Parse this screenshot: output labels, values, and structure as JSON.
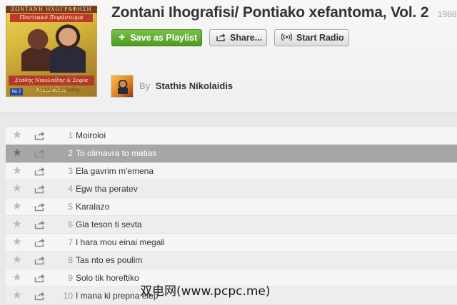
{
  "album": {
    "title": "Zontani Ihografisi/ Pontiako xefantoma, Vol. 2",
    "year": "1988",
    "cover_icon": "album-cover-image"
  },
  "cover_art": {
    "top_band": "ΖΩΝΤΑΝΗ ΗΧΟΓΡΑΦΗΣΗ",
    "title": "Ποντιακό Ξεφάντωμα",
    "artists": "Στάθης Νικολαΐδης & Σοφία Νικολαΐδου",
    "tag": "No 2",
    "sub": "Στάθης Νικολαΐδης"
  },
  "actions": {
    "save_label": "Save as Playlist",
    "share_label": "Share...",
    "radio_label": "Start Radio",
    "save_icon": "plus-icon",
    "share_icon": "share-arrow-icon",
    "radio_icon": "broadcast-icon"
  },
  "artist": {
    "by_label": "By",
    "name": "Stathis Nikolaidis"
  },
  "colors": {
    "save_button": "#5aa82a",
    "selected_row": "#a6a6a6"
  },
  "tracks": [
    {
      "num": "1",
      "name": "Moiroloi"
    },
    {
      "num": "2",
      "name": "To olimavra to matias",
      "selected": true
    },
    {
      "num": "3",
      "name": "Ela gavrim m'emena"
    },
    {
      "num": "4",
      "name": "Egw tha peratev"
    },
    {
      "num": "5",
      "name": "Karalazo"
    },
    {
      "num": "6",
      "name": "Gia teson ti sevta"
    },
    {
      "num": "7",
      "name": "I hara mou einai megali"
    },
    {
      "num": "8",
      "name": "Tas nto es poulim"
    },
    {
      "num": "9",
      "name": "Solo tik horeftiko"
    },
    {
      "num": "10",
      "name": "I mana ki prepna elep"
    }
  ],
  "watermark": "双电网(www.pcpc.me)"
}
